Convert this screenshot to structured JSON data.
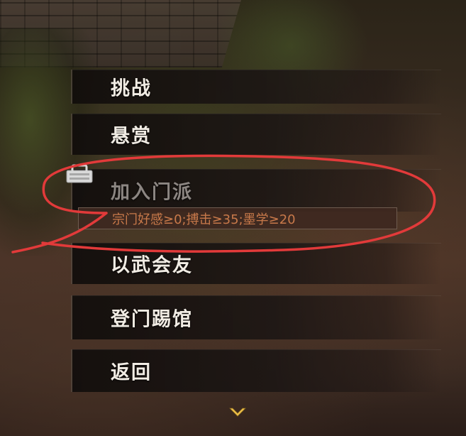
{
  "menu": {
    "challenge": "挑战",
    "bounty": "悬赏",
    "join_sect": "加入门派",
    "make_friends": "以武会友",
    "visit_challenge": "登门踢馆",
    "return": "返回"
  },
  "join_requirements": "宗门好感≥0;搏击≥35;墨学≥20",
  "icons": {
    "locked": "lock-icon",
    "scroll": "chevron-down-icon"
  },
  "colors": {
    "annotation_circle": "#e23a3a",
    "requirement_text": "#c8794a",
    "disabled_label": "#8c8682"
  }
}
